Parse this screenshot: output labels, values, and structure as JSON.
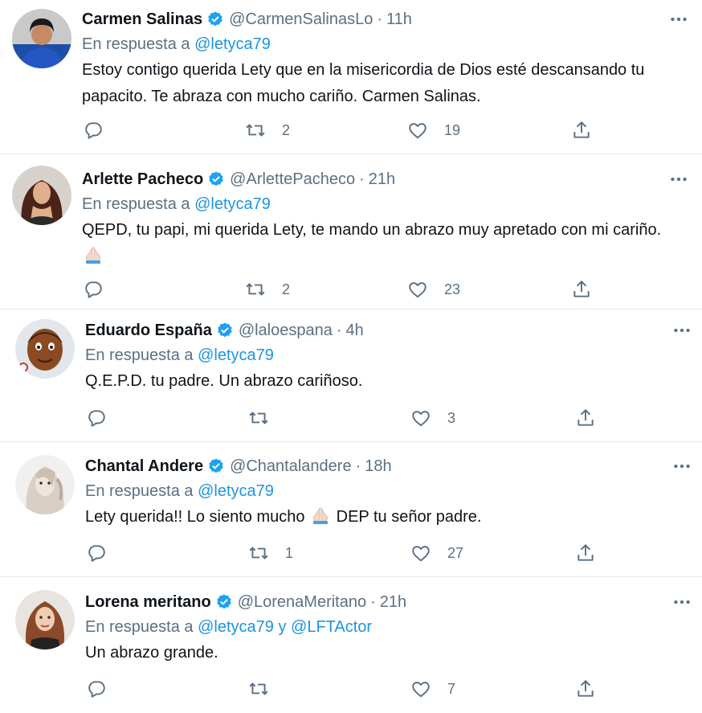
{
  "colors": {
    "text": "#0f1419",
    "secondary": "#5b7083",
    "link": "#1b95e0",
    "verified": "#1da1f2",
    "divider": "#e6ecf0"
  },
  "tweets": [
    {
      "name": "Carmen Salinas",
      "handle": "@CarmenSalinasLo",
      "time": "11h",
      "reply_prefix": "En respuesta a ",
      "mentions": [
        "@letyca79"
      ],
      "text": "Estoy contigo querida Lety que en la misericordia de Dios esté descansando tu papacito. Te abraza con mucho cariño. Carmen Salinas.",
      "text_after_emoji": "",
      "retweets": "2",
      "likes": "19"
    },
    {
      "name": "Arlette Pacheco",
      "handle": "@ArlettePacheco",
      "time": "21h",
      "reply_prefix": "En respuesta a ",
      "mentions": [
        "@letyca79"
      ],
      "text": "QEPD, tu papi, mi querida Lety, te mando un abrazo muy apretado con mi cariño.",
      "text_after_emoji": "",
      "retweets": "2",
      "likes": "23"
    },
    {
      "name": "Eduardo España",
      "handle": "@laloespana",
      "time": "4h",
      "reply_prefix": "En respuesta a ",
      "mentions": [
        "@letyca79"
      ],
      "text": "Q.E.P.D. tu padre. Un abrazo cariñoso.",
      "text_after_emoji": "",
      "retweets": "",
      "likes": "3"
    },
    {
      "name": "Chantal Andere",
      "handle": "@Chantalandere",
      "time": "18h",
      "reply_prefix": "En respuesta a ",
      "mentions": [
        "@letyca79"
      ],
      "text": "Lety querida!! Lo siento mucho",
      "text_after_emoji": "DEP tu señor padre.",
      "retweets": "1",
      "likes": "27"
    },
    {
      "name": "Lorena meritano",
      "handle": "@LorenaMeritano",
      "time": "21h",
      "reply_prefix": "En respuesta a ",
      "mentions": [
        "@letyca79",
        "@LFTActor"
      ],
      "mention_joiner": " y ",
      "text": "Un abrazo grande.",
      "text_after_emoji": "",
      "retweets": "",
      "likes": "7"
    }
  ]
}
